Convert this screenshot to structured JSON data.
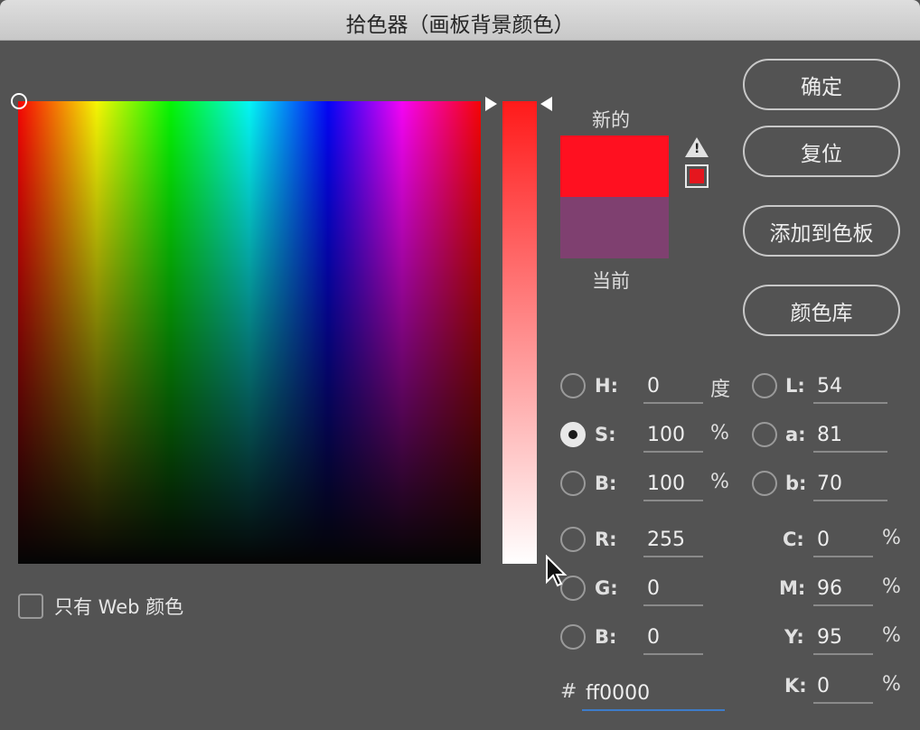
{
  "window": {
    "title": "拾色器（画板背景颜色）"
  },
  "preview": {
    "new_label": "新的",
    "current_label": "当前",
    "new_color": "#ff1020",
    "current_color": "#7f4070"
  },
  "buttons": {
    "ok": "确定",
    "reset": "复位",
    "add_to_swatches": "添加到色板",
    "color_libraries": "颜色库"
  },
  "hsb": {
    "h_label": "H:",
    "h_value": "0",
    "h_unit": "度",
    "s_label": "S:",
    "s_value": "100",
    "s_unit": "%",
    "b_label": "B:",
    "b_value": "100",
    "b_unit": "%"
  },
  "rgb": {
    "r_label": "R:",
    "r_value": "255",
    "g_label": "G:",
    "g_value": "0",
    "b_label": "B:",
    "b_value": "0"
  },
  "lab": {
    "l_label": "L:",
    "l_value": "54",
    "a_label": "a:",
    "a_value": "81",
    "b_label": "b:",
    "b_value": "70"
  },
  "cmyk": {
    "c_label": "C:",
    "c_value": "0",
    "m_label": "M:",
    "m_value": "96",
    "y_label": "Y:",
    "y_value": "95",
    "k_label": "K:",
    "k_value": "0",
    "unit": "%"
  },
  "hex": {
    "label": "#",
    "value": "ff0000"
  },
  "web_only": {
    "label": "只有 Web 颜色"
  },
  "icons": {
    "warning": "warning-triangle-icon",
    "gamut": "gamut-swatch-icon",
    "cursor": "mouse-pointer-icon"
  },
  "colors": {
    "gamut_swatch": "#e5161e",
    "hex_focus": "#3d7cc9"
  }
}
